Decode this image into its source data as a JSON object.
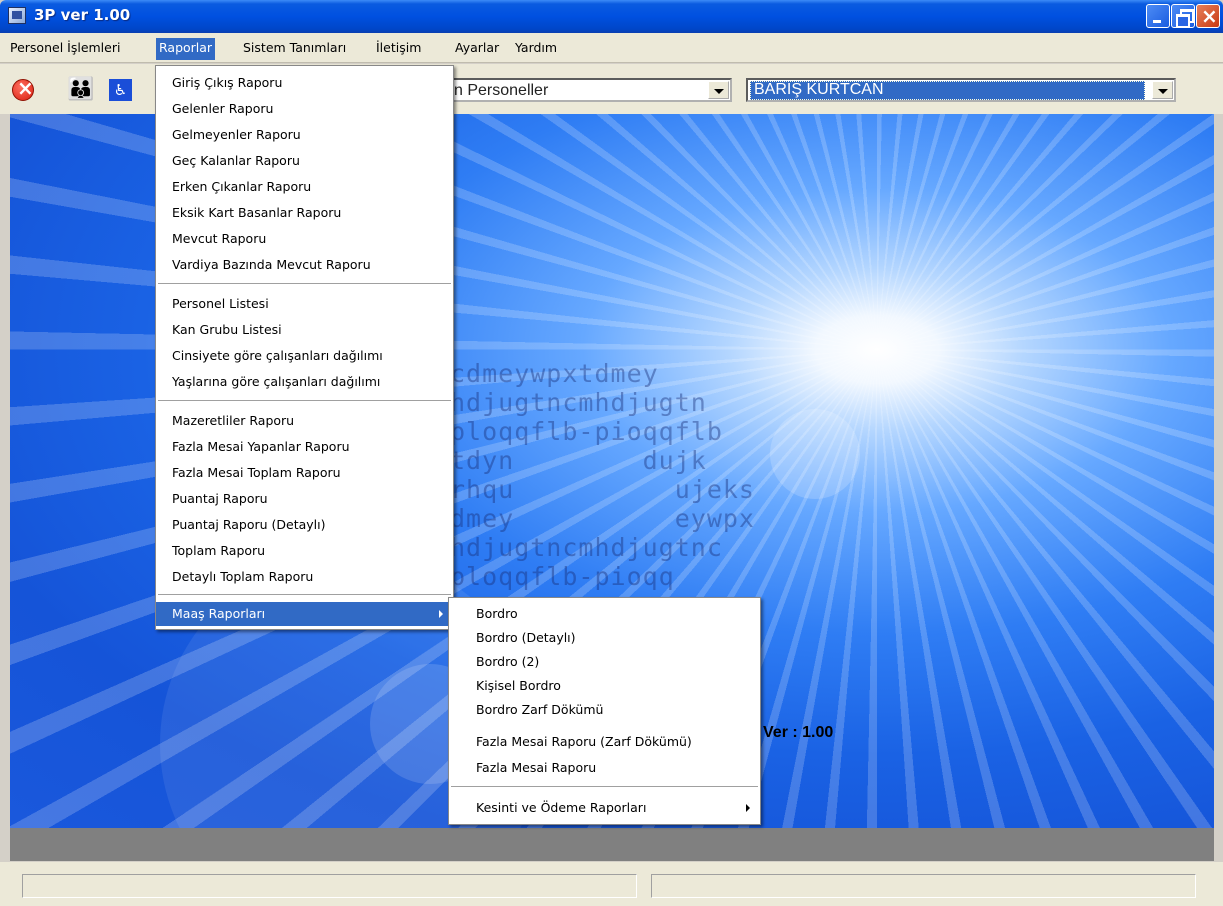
{
  "window": {
    "title": "3P ver 1.00"
  },
  "menubar": {
    "items": [
      "Personel İşlemleri",
      "Raporlar",
      "Sistem Tanımları",
      "İletişim",
      "Ayarlar",
      "Yardım"
    ],
    "active": "Raporlar"
  },
  "toolbar": {
    "icons": [
      "exit-icon",
      "people-icon",
      "accessibility-icon"
    ],
    "combo_group": {
      "value": "n Personeller"
    },
    "combo_person": {
      "value": "BARIŞ KURTCAN"
    }
  },
  "raporlar_menu": {
    "group1": [
      "Giriş Çıkış Raporu",
      "Gelenler Raporu",
      "Gelmeyenler Raporu",
      "Geç Kalanlar Raporu",
      "Erken Çıkanlar Raporu",
      "Eksik Kart Basanlar Raporu",
      "Mevcut Raporu",
      "Vardiya Bazında Mevcut Raporu"
    ],
    "group2": [
      "Personel Listesi",
      "Kan Grubu Listesi",
      "Cinsiyete göre çalışanları dağılımı",
      "Yaşlarına göre çalışanları dağılımı"
    ],
    "group3": [
      "Mazeretliler Raporu",
      "Fazla Mesai Yapanlar Raporu",
      "Fazla Mesai Toplam Raporu",
      "Puantaj Raporu",
      "Puantaj Raporu (Detaylı)",
      "Toplam Raporu",
      "Detaylı Toplam Raporu"
    ],
    "submenu_item": "Maaş Raporları"
  },
  "maas_menu": {
    "items": [
      "Bordro",
      "Bordro (Detaylı)",
      "Bordro (2)",
      "Kişisel Bordro",
      "Bordro Zarf Dökümü",
      "Fazla Mesai Raporu (Zarf Dökümü)",
      "Fazla Mesai Raporu"
    ],
    "submenu_item": "Kesinti ve Ödeme Raporları"
  },
  "splash": {
    "logo_text": [
      "cdmeywpxtdmey",
      "hdjugtncmhdjugtn",
      "ploqqflb-pioqqflb",
      "tdyn        dujk",
      "rhqu          ujeks",
      "dmey          eywpx",
      "hdjugtncmhdjugtnc",
      "ploqqflb-pioqq"
    ],
    "version": "Ver : 1.00"
  },
  "colors": {
    "titlebar": "#0050e0",
    "menu_highlight": "#316ac5",
    "workspace": "#1a62e4"
  }
}
